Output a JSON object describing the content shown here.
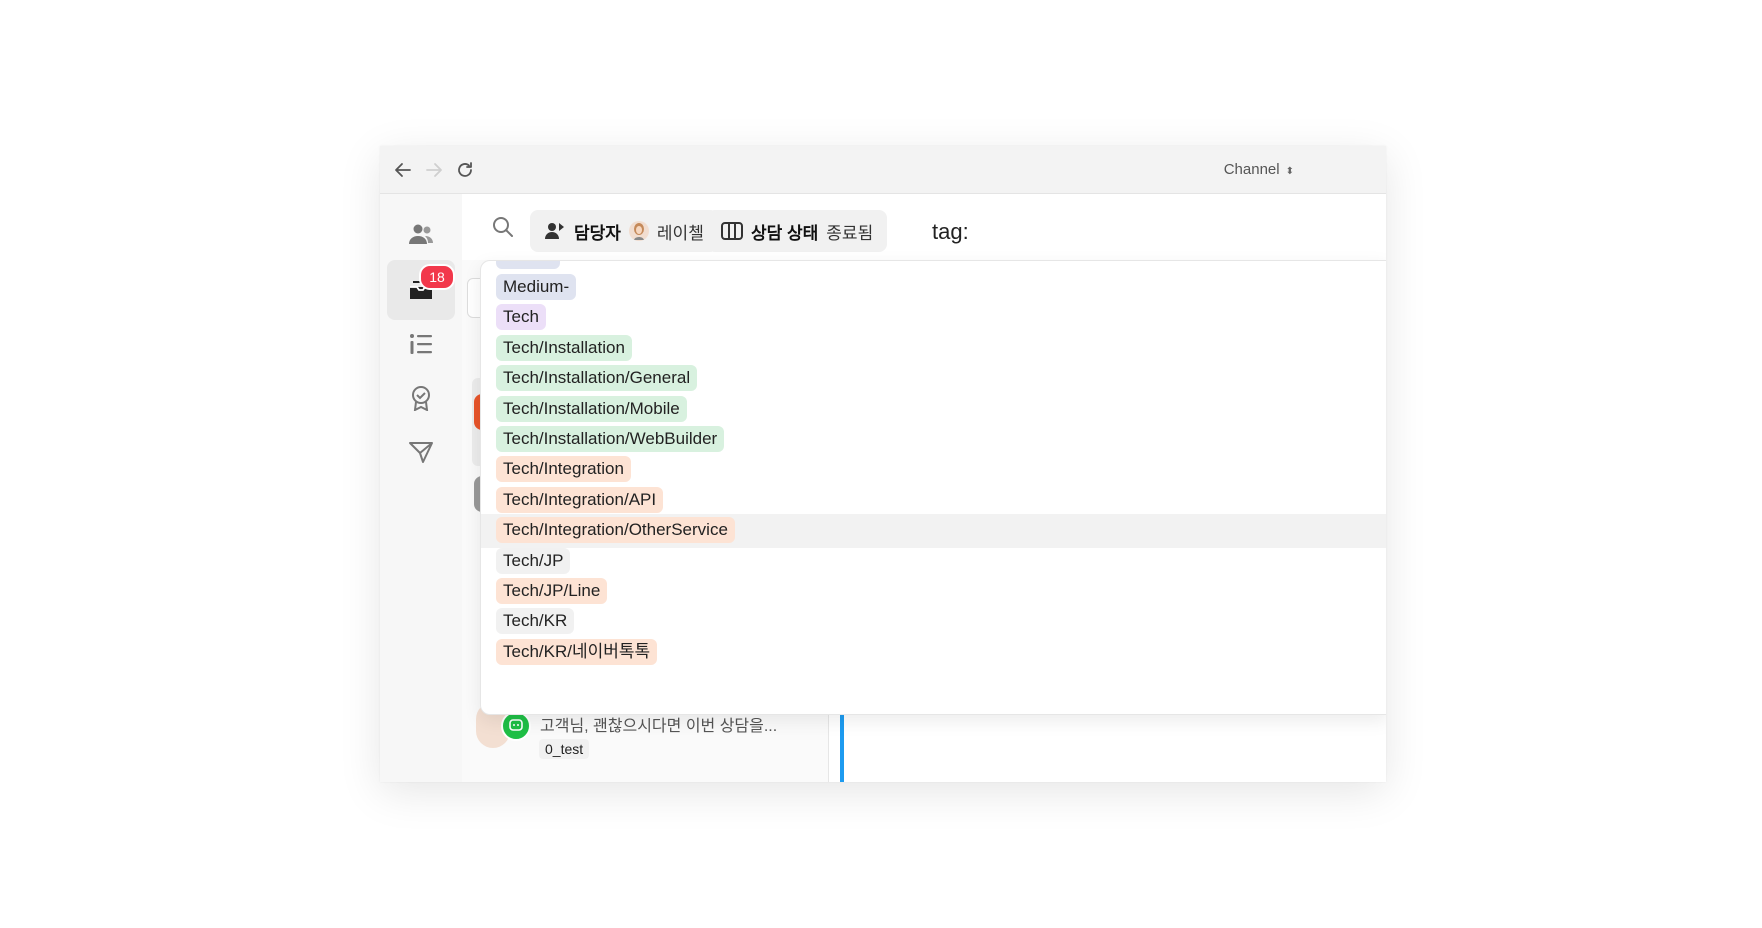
{
  "channel_switcher": {
    "label": "Channel",
    "arrows": "⬍"
  },
  "sidebar": {
    "inbox_badge": "18"
  },
  "filters": {
    "assignee": {
      "key": "담당자",
      "value": "레이첼"
    },
    "status": {
      "key": "상담 상태",
      "value": "종료됨"
    },
    "query": "tag:"
  },
  "tags": [
    {
      "label": "Medium-",
      "color": "#dfe3f0"
    },
    {
      "label": "Tech",
      "color": "#ecdff8"
    },
    {
      "label": "Tech/Installation",
      "color": "#d8f1df"
    },
    {
      "label": "Tech/Installation/General",
      "color": "#d8f1df"
    },
    {
      "label": "Tech/Installation/Mobile",
      "color": "#d8f1df"
    },
    {
      "label": "Tech/Installation/WebBuilder",
      "color": "#d8f1df"
    },
    {
      "label": "Tech/Integration",
      "color": "#fde3d4"
    },
    {
      "label": "Tech/Integration/API",
      "color": "#fde3d4"
    },
    {
      "label": "Tech/Integration/OtherService",
      "color": "#fde3d4"
    },
    {
      "label": "Tech/JP",
      "color": "#f1f1f1"
    },
    {
      "label": "Tech/JP/Line",
      "color": "#fde3d4"
    },
    {
      "label": "Tech/KR",
      "color": "#f1f1f1"
    },
    {
      "label": "Tech/KR/네이버톡톡",
      "color": "#fde3d4"
    }
  ],
  "conversation_preview": {
    "message": "고객님, 괜찮으시다면 이번 상담을...",
    "tag": "0_test"
  }
}
